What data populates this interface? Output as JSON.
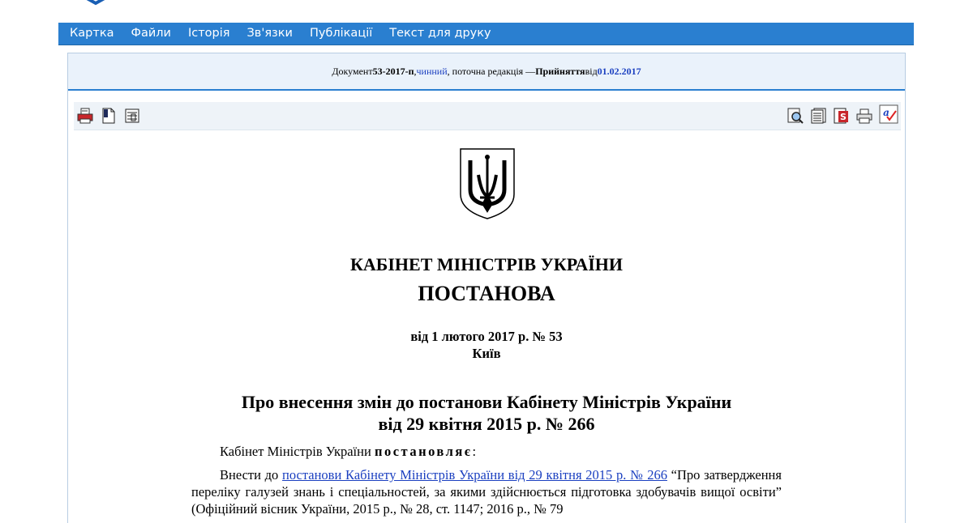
{
  "nav": {
    "items": [
      "Картка",
      "Файли",
      "Історія",
      "Зв'язки",
      "Публікації",
      "Текст для друку"
    ]
  },
  "doc_header": {
    "prefix": "Документ ",
    "number": "53-2017-п",
    "sep1": ", ",
    "status": "чинний",
    "edition": ", поточна редакція — ",
    "accepted": "Прийняття",
    "from": " від ",
    "date": "01.02.2017"
  },
  "toolbar": {
    "left_icons": [
      "print-icon",
      "document-icon",
      "compare-icon"
    ],
    "right_icons": [
      "search-icon",
      "list-icon",
      "sign-icon",
      "printer-icon",
      "check-icon"
    ]
  },
  "document": {
    "org": "КАБІНЕТ МІНІСТРІВ УКРАЇНИ",
    "type": "ПОСТАНОВА",
    "date": "від 1 лютого 2017 р. № 53",
    "city": "Київ",
    "title_line1": "Про внесення змін до постанови Кабінету Міністрів України",
    "title_line2": "від 29 квітня 2015 р. № 266",
    "intro_prefix": "Кабінет Міністрів України ",
    "intro_spaced": "постановляє",
    "intro_suffix": ":",
    "body_prefix": "Внести до ",
    "body_link": "постанови Кабінету Міністрів України від 29 квітня 2015 р. № 266",
    "body_rest": " “Про затвердження переліку галузей знань і спеціальностей, за якими здійснюється підготовка здобувачів вищої освіти” (Офіційний вісник України, 2015 р., № 28, ст. 1147; 2016 р., № 79"
  },
  "colors": {
    "nav_bg": "#2a7fd0",
    "header_bg": "#eaf2fb",
    "link": "#1a3fc0"
  }
}
